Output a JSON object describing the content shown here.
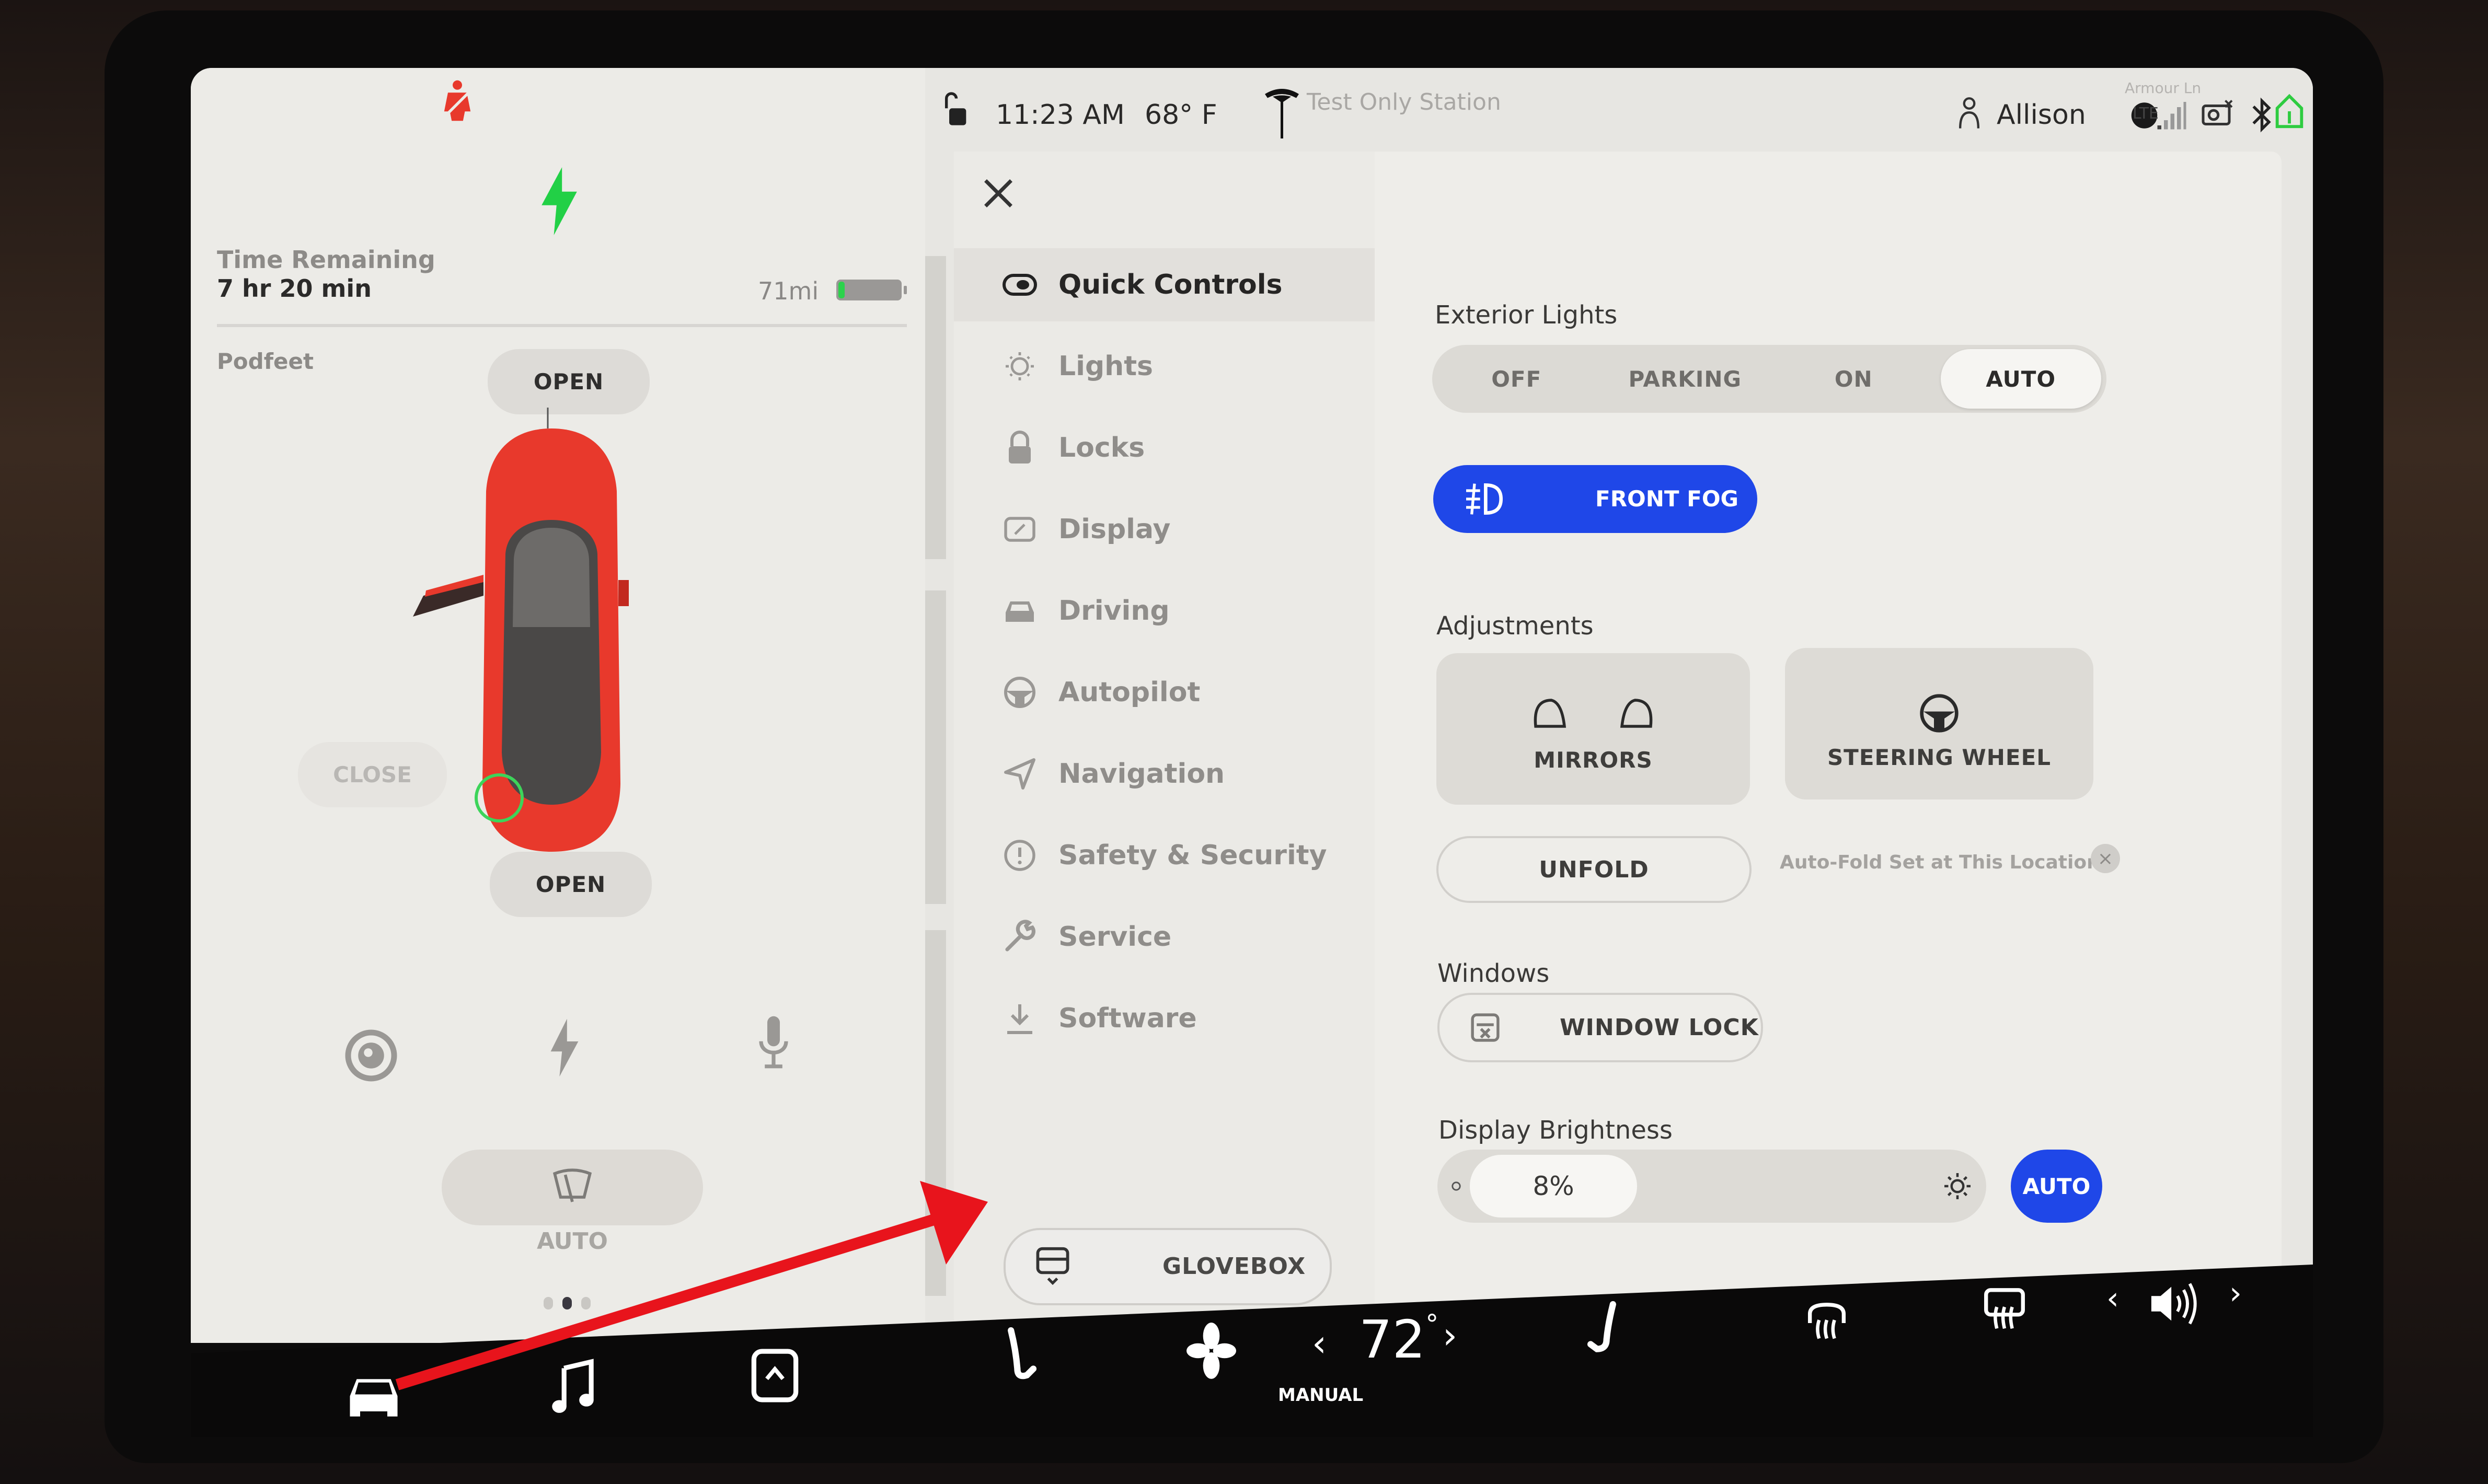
{
  "status_bar": {
    "lock_icon": "unlocked-padlock-icon",
    "time": "11:23 AM",
    "temperature": "68° F",
    "brand_icon": "tesla-logo-icon",
    "map_poi": "Test Only Station",
    "map_street": "Armour Ln",
    "user_icon": "person-icon",
    "user_name": "Allison",
    "icons": [
      "ball-icon",
      "camera-off-icon",
      "home-link-icon",
      "lte-signal-icon",
      "bluetooth-icon"
    ],
    "lte_label": "LTE",
    "home_color": "#2ecc40"
  },
  "car_panel": {
    "seatbelt_warning_color": "#e8392c",
    "charging_color": "#22d046",
    "time_remaining_label": "Time Remaining",
    "time_remaining_value": "7 hr 20 min",
    "range": "71mi",
    "battery_level": 0.1,
    "car_name": "Podfeet",
    "frunk_button": "OPEN",
    "trunk_button": "OPEN",
    "charge_port_button": "CLOSE",
    "car_color": "#e8392c",
    "quick_icons": [
      "dashcam-icon",
      "charge-icon",
      "microphone-icon"
    ],
    "wiper_label": "AUTO",
    "pager": {
      "count": 3,
      "active": 1
    }
  },
  "nav": {
    "close_icon": "close-icon",
    "items": [
      {
        "label": "Quick Controls",
        "icon": "toggle-icon",
        "active": true
      },
      {
        "label": "Lights",
        "icon": "lightbulb-icon",
        "active": false
      },
      {
        "label": "Locks",
        "icon": "lock-icon",
        "active": false
      },
      {
        "label": "Display",
        "icon": "display-icon",
        "active": false
      },
      {
        "label": "Driving",
        "icon": "car-icon",
        "active": false
      },
      {
        "label": "Autopilot",
        "icon": "steering-wheel-icon",
        "active": false
      },
      {
        "label": "Navigation",
        "icon": "navigation-arrow-icon",
        "active": false
      },
      {
        "label": "Safety & Security",
        "icon": "alert-circle-icon",
        "active": false
      },
      {
        "label": "Service",
        "icon": "wrench-icon",
        "active": false
      },
      {
        "label": "Software",
        "icon": "download-icon",
        "active": false
      }
    ],
    "glovebox_label": "GLOVEBOX"
  },
  "quick_controls": {
    "exterior_lights": {
      "title": "Exterior Lights",
      "options": [
        "OFF",
        "PARKING",
        "ON",
        "AUTO"
      ],
      "selected": "AUTO"
    },
    "front_fog": {
      "label": "FRONT FOG",
      "active": true,
      "color": "#1f47e8"
    },
    "adjustments": {
      "title": "Adjustments",
      "mirrors_label": "MIRRORS",
      "steering_label": "STEERING WHEEL",
      "unfold_label": "UNFOLD",
      "autofold_note": "Auto-Fold Set at This Location"
    },
    "windows": {
      "title": "Windows",
      "window_lock_label": "WINDOW LOCK"
    },
    "brightness": {
      "title": "Display Brightness",
      "value": "8%",
      "level": 0.08,
      "auto_label": "AUTO"
    }
  },
  "dock": {
    "icons": [
      "car-icon",
      "music-icon",
      "app-launcher-icon",
      "driver-seat-heater-icon",
      "fan-icon",
      "passenger-seat-heater-icon",
      "front-defrost-icon",
      "rear-defrost-icon",
      "volume-icon"
    ],
    "temperature": "72",
    "degree": "°",
    "climate_mode": "MANUAL"
  },
  "annotation": {
    "arrow_color": "#e8141c"
  }
}
